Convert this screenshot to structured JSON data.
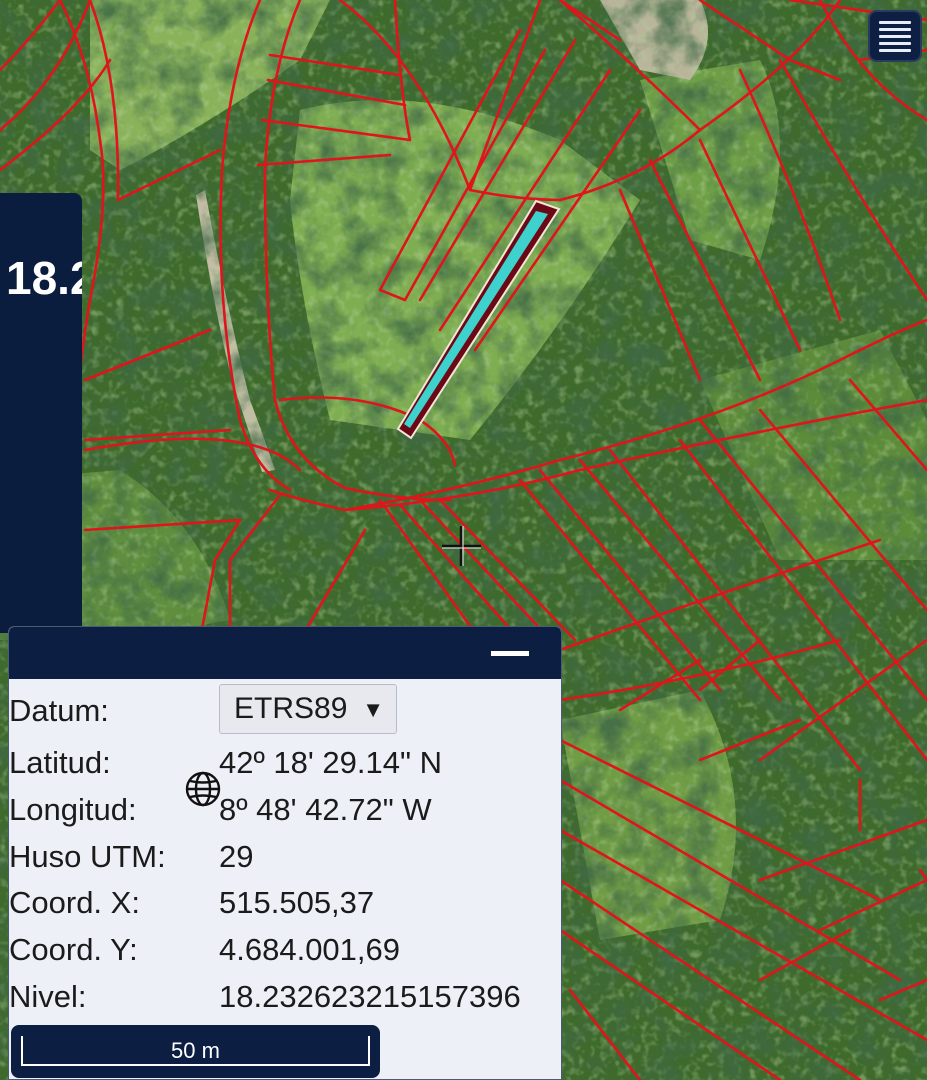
{
  "app": {
    "menu_icon": "hamburger-menu-icon",
    "crosshair_icon": "crosshair-icon",
    "globe_icon": "globe-icon"
  },
  "left_panel": {
    "partial_text": "18.2"
  },
  "info_panel": {
    "rows": [
      {
        "label": "Datum:",
        "value": "ETRS89"
      },
      {
        "label": "Latitud:",
        "value": "42º 18' 29.14\" N"
      },
      {
        "label": "Longitud:",
        "value": "8º 48' 42.72\" W"
      },
      {
        "label": "Huso UTM:",
        "value": "29"
      },
      {
        "label": "Coord. X:",
        "value": "515.505,37"
      },
      {
        "label": "Coord. Y:",
        "value": "4.684.001,69"
      },
      {
        "label": "Nivel:",
        "value": "18.232623215157396"
      }
    ],
    "datum_dropdown_arrow": "▼"
  },
  "scale": {
    "label": "50 m"
  },
  "colors": {
    "parcel_lines": "#e0141b",
    "selected_parcel_outline": "#6b0a16",
    "selected_parcel_fill": "#3ed2cf",
    "panel_bg": "#0c1f43"
  }
}
